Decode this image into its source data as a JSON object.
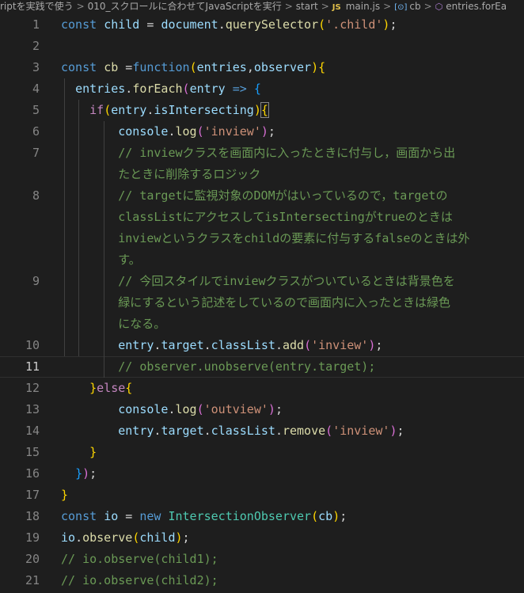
{
  "breadcrumb": {
    "items": [
      "riptを実践で使う",
      "010_スクロールに合わせてJavaScriptを実行",
      "start",
      "main.js",
      "cb",
      "entries.forEa"
    ],
    "separator": ">",
    "js_badge": "JS",
    "icons": [
      "js-file-icon",
      "variable-brackets-icon",
      "method-cube-icon"
    ]
  },
  "editor": {
    "active_line": "11",
    "lines": [
      {
        "num": "1",
        "tokens": [
          [
            "const",
            "kw"
          ],
          [
            " "
          ],
          [
            "child",
            "var"
          ],
          [
            " = "
          ],
          [
            "document",
            "var"
          ],
          [
            "."
          ],
          [
            "querySelector",
            "fn"
          ],
          [
            "(",
            "yb"
          ],
          [
            "'.child'",
            "str"
          ],
          [
            ")",
            "yb"
          ],
          [
            ";"
          ]
        ]
      },
      {
        "num": "2",
        "tokens": []
      },
      {
        "num": "3",
        "tokens": [
          [
            "const",
            "kw"
          ],
          [
            " "
          ],
          [
            "cb",
            "fn"
          ],
          [
            " ="
          ],
          [
            "function",
            "kw"
          ],
          [
            "(",
            "yb"
          ],
          [
            "entries",
            "var"
          ],
          [
            ","
          ],
          [
            "observer",
            "var"
          ],
          [
            ")",
            "yb"
          ],
          [
            "{",
            "yb"
          ]
        ]
      },
      {
        "num": "4",
        "tokens": [
          [
            "  "
          ],
          [
            "entries",
            "var"
          ],
          [
            "."
          ],
          [
            "forEach",
            "fn"
          ],
          [
            "(",
            "pb"
          ],
          [
            "entry",
            "var"
          ],
          [
            " "
          ],
          [
            "=>",
            "kw"
          ],
          [
            " "
          ],
          [
            "{",
            "bb"
          ]
        ]
      },
      {
        "num": "5",
        "tokens": [
          [
            "    "
          ],
          [
            "if",
            "ctl"
          ],
          [
            "(",
            "yb"
          ],
          [
            "entry",
            "var"
          ],
          [
            "."
          ],
          [
            "isIntersecting",
            "var"
          ],
          [
            ")",
            "yb"
          ],
          [
            "{",
            "yb"
          ]
        ]
      },
      {
        "num": "6",
        "tokens": [
          [
            "        "
          ],
          [
            "console",
            "var"
          ],
          [
            "."
          ],
          [
            "log",
            "fn"
          ],
          [
            "(",
            "pb"
          ],
          [
            "'inview'",
            "str"
          ],
          [
            ")",
            "pb"
          ],
          [
            ";"
          ]
        ]
      },
      {
        "num": "7",
        "tokens": [
          [
            "        "
          ],
          [
            "// inviewクラスを画面内に入ったときに付与し，画面から出",
            "cmt"
          ]
        ]
      },
      {
        "num": "",
        "tokens": [
          [
            "        "
          ],
          [
            "たときに削除するロジック",
            "cmt"
          ]
        ]
      },
      {
        "num": "8",
        "tokens": [
          [
            "        "
          ],
          [
            "// targetに監視対象のDOMがはいっているので，targetの",
            "cmt"
          ]
        ]
      },
      {
        "num": "",
        "tokens": [
          [
            "        "
          ],
          [
            "classListにアクセスしてisIntersectingがtrueのときは",
            "cmt"
          ]
        ]
      },
      {
        "num": "",
        "tokens": [
          [
            "        "
          ],
          [
            "inviewというクラスをchildの要素に付与するfalseのときは外",
            "cmt"
          ]
        ]
      },
      {
        "num": "",
        "tokens": [
          [
            "        "
          ],
          [
            "す。",
            "cmt"
          ]
        ]
      },
      {
        "num": "9",
        "tokens": [
          [
            "        "
          ],
          [
            "// 今回スタイルでinviewクラスがついているときは背景色を",
            "cmt"
          ]
        ]
      },
      {
        "num": "",
        "tokens": [
          [
            "        "
          ],
          [
            "緑にするという記述をしているので画面内に入ったときは緑色",
            "cmt"
          ]
        ]
      },
      {
        "num": "",
        "tokens": [
          [
            "        "
          ],
          [
            "になる。",
            "cmt"
          ]
        ]
      },
      {
        "num": "10",
        "tokens": [
          [
            "        "
          ],
          [
            "entry",
            "var"
          ],
          [
            "."
          ],
          [
            "target",
            "var"
          ],
          [
            "."
          ],
          [
            "classList",
            "var"
          ],
          [
            "."
          ],
          [
            "add",
            "fn"
          ],
          [
            "(",
            "pb"
          ],
          [
            "'inview'",
            "str"
          ],
          [
            ")",
            "pb"
          ],
          [
            ";"
          ]
        ]
      },
      {
        "num": "11",
        "tokens": [
          [
            "        "
          ],
          [
            "// observer.unobserve(entry.target);",
            "cmt"
          ]
        ]
      },
      {
        "num": "12",
        "tokens": [
          [
            "    "
          ],
          [
            "}",
            "yb"
          ],
          [
            "else",
            "ctl"
          ],
          [
            "{",
            "yb"
          ]
        ]
      },
      {
        "num": "13",
        "tokens": [
          [
            "        "
          ],
          [
            "console",
            "var"
          ],
          [
            "."
          ],
          [
            "log",
            "fn"
          ],
          [
            "(",
            "pb"
          ],
          [
            "'outview'",
            "str"
          ],
          [
            ")",
            "pb"
          ],
          [
            ";"
          ]
        ]
      },
      {
        "num": "14",
        "tokens": [
          [
            "        "
          ],
          [
            "entry",
            "var"
          ],
          [
            "."
          ],
          [
            "target",
            "var"
          ],
          [
            "."
          ],
          [
            "classList",
            "var"
          ],
          [
            "."
          ],
          [
            "remove",
            "fn"
          ],
          [
            "(",
            "pb"
          ],
          [
            "'inview'",
            "str"
          ],
          [
            ")",
            "pb"
          ],
          [
            ";"
          ]
        ]
      },
      {
        "num": "15",
        "tokens": [
          [
            "    "
          ],
          [
            "}",
            "yb"
          ]
        ]
      },
      {
        "num": "16",
        "tokens": [
          [
            "  "
          ],
          [
            "}",
            "bb"
          ],
          [
            ")",
            "pb"
          ],
          [
            ";"
          ]
        ]
      },
      {
        "num": "17",
        "tokens": [
          [
            "}",
            "yb"
          ]
        ]
      },
      {
        "num": "18",
        "tokens": [
          [
            "const",
            "kw"
          ],
          [
            " "
          ],
          [
            "io",
            "var"
          ],
          [
            " = "
          ],
          [
            "new",
            "kw"
          ],
          [
            " "
          ],
          [
            "IntersectionObserver",
            "cls"
          ],
          [
            "(",
            "yb"
          ],
          [
            "cb",
            "var"
          ],
          [
            ")",
            "yb"
          ],
          [
            ";"
          ]
        ]
      },
      {
        "num": "19",
        "tokens": [
          [
            "io",
            "var"
          ],
          [
            "."
          ],
          [
            "observe",
            "fn"
          ],
          [
            "(",
            "yb"
          ],
          [
            "child",
            "var"
          ],
          [
            ")",
            "yb"
          ],
          [
            ";"
          ]
        ]
      },
      {
        "num": "20",
        "tokens": [
          [
            "// io.observe(child1);",
            "cmt"
          ]
        ]
      },
      {
        "num": "21",
        "tokens": [
          [
            "// io.observe(child2);",
            "cmt"
          ]
        ]
      }
    ]
  }
}
